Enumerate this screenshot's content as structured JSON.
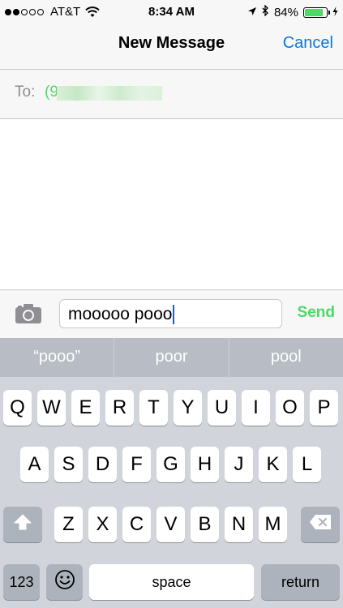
{
  "status_bar": {
    "carrier": "AT&T",
    "signal_full": 2,
    "signal_empty": 3,
    "time": "8:34 AM",
    "battery_percent": "84%",
    "battery_level": 0.84,
    "battery_color": "#4cd964"
  },
  "nav": {
    "title": "New Message",
    "cancel": "Cancel"
  },
  "to": {
    "label": "To:",
    "value_visible": "(9"
  },
  "composer": {
    "text": "mooooo pooo",
    "send": "Send",
    "accent_color": "#4cd964"
  },
  "predictive": [
    "“pooo”",
    "poor",
    "pool"
  ],
  "keyboard": {
    "row1": [
      "Q",
      "W",
      "E",
      "R",
      "T",
      "Y",
      "U",
      "I",
      "O",
      "P"
    ],
    "row2": [
      "A",
      "S",
      "D",
      "F",
      "G",
      "H",
      "J",
      "K",
      "L"
    ],
    "row3": [
      "Z",
      "X",
      "C",
      "V",
      "B",
      "N",
      "M"
    ],
    "numbers": "123",
    "space": "space",
    "return": "return",
    "shift_icon": "shift-icon",
    "delete_icon": "delete-icon",
    "emoji_icon": "emoji-icon"
  }
}
